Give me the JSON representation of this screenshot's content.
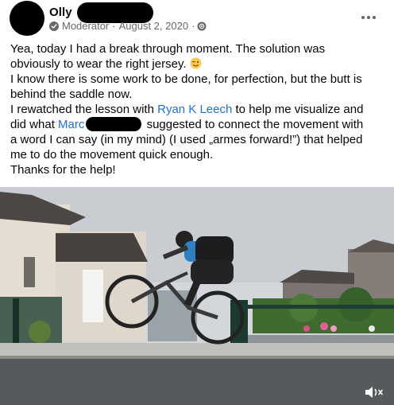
{
  "post": {
    "author_name": "Olly",
    "role": "Moderator",
    "separator": "·",
    "date": "August 2, 2020",
    "separator2": "·",
    "line1": "Yea, today I had a break through moment. The solution was",
    "line2": "obviously to wear the right jersey.",
    "line3": "I know there is some work to be done, for perfection, but the butt is",
    "line4": "behind the saddle now.",
    "line5_pre": "I rewatched the lesson with",
    "line5_link": "Ryan K Leech",
    "line5_post": "to help me visualize and",
    "line6_pre": "did what",
    "line6_link": "Marc",
    "line6_post": "suggested to connect the movement with",
    "line7": "a word I can say (in my mind) (I used „armes forward!”) that helped",
    "line8": "me to do the movement quick enough.",
    "line9": "Thanks for the help!"
  },
  "icons": {
    "more": "more-horizontal-icon",
    "moderator": "moderator-badge-icon",
    "audience": "globe-icon",
    "emoji": "winking-face-emoji",
    "mute": "volume-muted-icon"
  },
  "colors": {
    "link": "#216fdb",
    "secondary_text": "#65676b",
    "text": "#050505"
  }
}
